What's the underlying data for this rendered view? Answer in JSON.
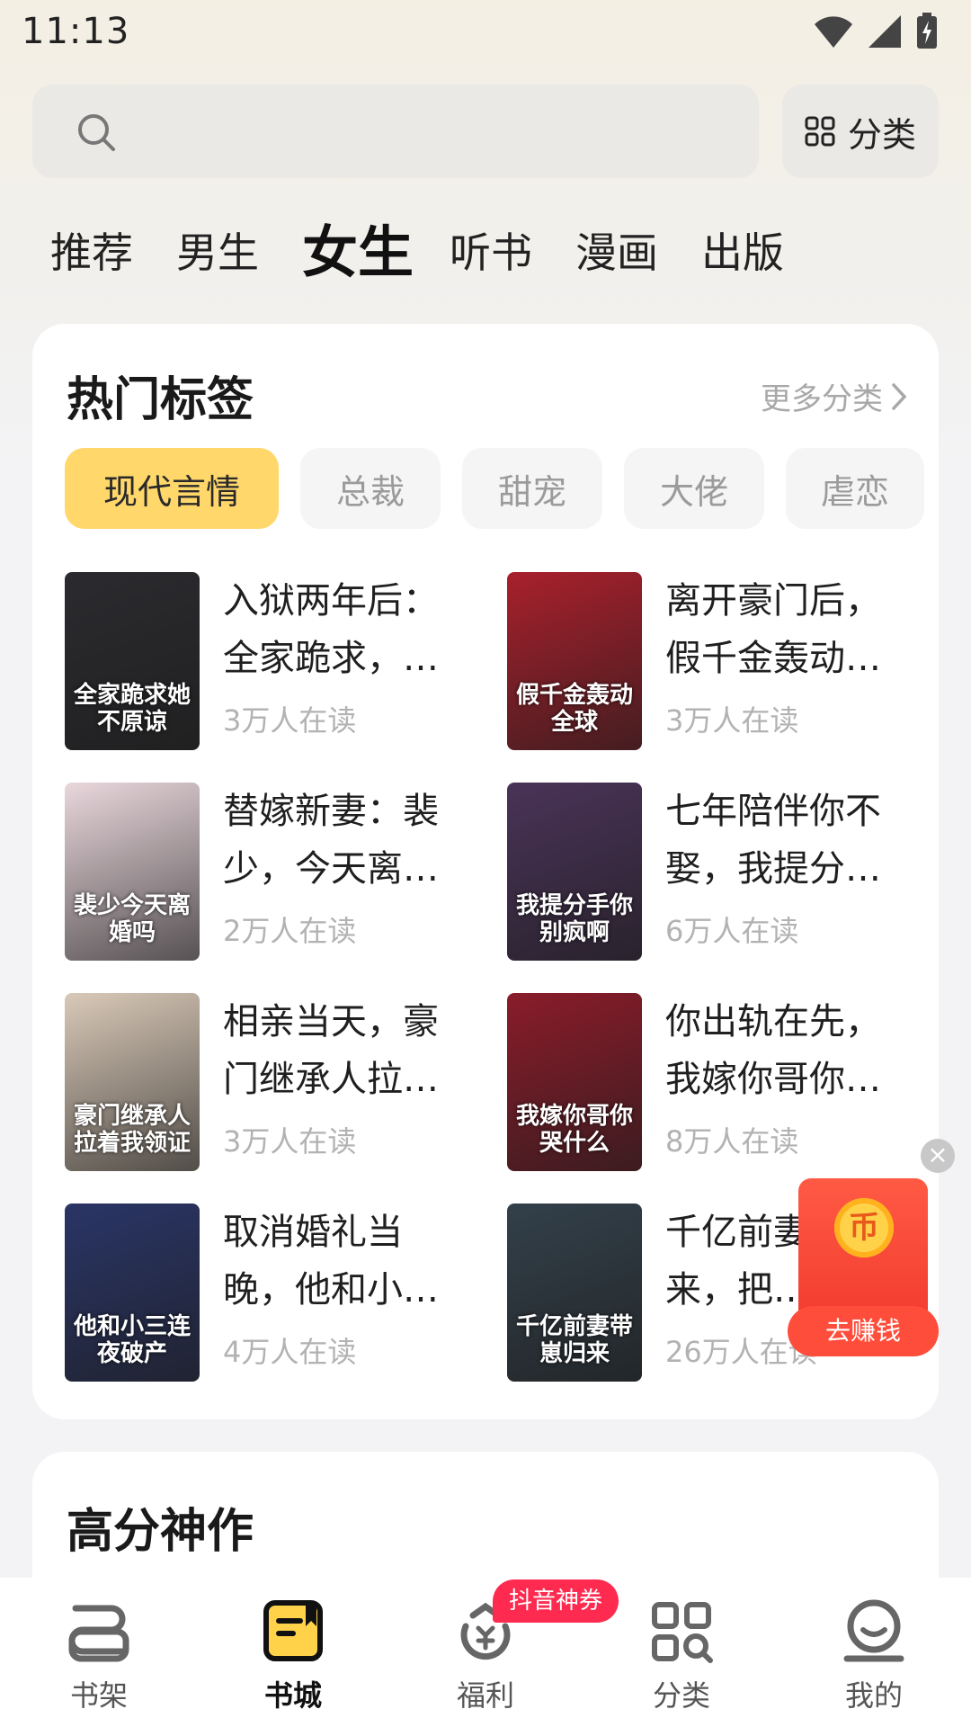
{
  "status_bar": {
    "time": "11:13"
  },
  "search": {
    "placeholder": ""
  },
  "category_button": {
    "label": "分类",
    "icon": "grid-icon"
  },
  "channel_tabs": [
    {
      "label": "推荐",
      "active": false
    },
    {
      "label": "男生",
      "active": false
    },
    {
      "label": "女生",
      "active": true
    },
    {
      "label": "听书",
      "active": false
    },
    {
      "label": "漫画",
      "active": false
    },
    {
      "label": "出版",
      "active": false
    }
  ],
  "hot_tags": {
    "title": "热门标签",
    "more_label": "更多分类",
    "tags": [
      "现代言情",
      "总裁",
      "甜宠",
      "大佬",
      "虐恋"
    ],
    "active_tag": "现代言情",
    "books": [
      {
        "title": "入狱两年后：全家跪求，…",
        "readers": "3万人在读",
        "cover_text": "全家跪求她不原谅",
        "cover_color": "#2b2b2f"
      },
      {
        "title": "离开豪门后，假千金轰动…",
        "readers": "3万人在读",
        "cover_text": "假千金轰动全球",
        "cover_color": "#a8202c"
      },
      {
        "title": "替嫁新妻：裴少，今天离…",
        "readers": "2万人在读",
        "cover_text": "裴少今天离婚吗",
        "cover_color": "#e9d7dc"
      },
      {
        "title": "七年陪伴你不娶，我提分…",
        "readers": "6万人在读",
        "cover_text": "我提分手你别疯啊",
        "cover_color": "#4a3358"
      },
      {
        "title": "相亲当天，豪门继承人拉…",
        "readers": "3万人在读",
        "cover_text": "豪门继承人拉着我领证",
        "cover_color": "#d9c9b8"
      },
      {
        "title": "你出轨在先，我嫁你哥你…",
        "readers": "8万人在读",
        "cover_text": "我嫁你哥你哭什么",
        "cover_color": "#8a1c2a"
      },
      {
        "title": "取消婚礼当晚，他和小…",
        "readers": "4万人在读",
        "cover_text": "他和小三连夜破产",
        "cover_color": "#2a3566"
      },
      {
        "title": "千亿前妻归来，把…",
        "readers": "26万人在读",
        "cover_text": "千亿前妻带崽归来",
        "cover_color": "#33404a"
      }
    ]
  },
  "second_section": {
    "title": "高分神作"
  },
  "floating_reward": {
    "label": "去赚钱",
    "coin_glyph": "币"
  },
  "bottom_nav": [
    {
      "label": "书架",
      "icon": "bookshelf-icon",
      "active": false
    },
    {
      "label": "书城",
      "icon": "bookstore-icon",
      "active": true
    },
    {
      "label": "福利",
      "icon": "welfare-icon",
      "active": false
    },
    {
      "label": "分类",
      "icon": "category-icon",
      "active": false
    },
    {
      "label": "我的",
      "icon": "profile-icon",
      "active": false
    }
  ],
  "nav_badge": "抖音神券"
}
